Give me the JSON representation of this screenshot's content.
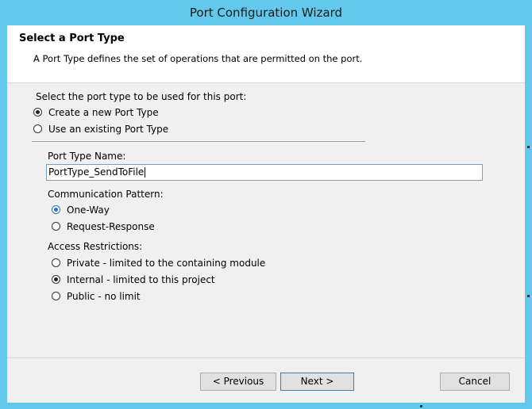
{
  "window": {
    "title": "Port Configuration Wizard"
  },
  "header": {
    "title": "Select a Port Type",
    "description": "A Port Type defines the set of operations that are permitted on the port."
  },
  "port_type_choice": {
    "prompt": "Select the port type to be used for this port:",
    "create_new": "Create a new Port Type",
    "use_existing": "Use an existing Port Type",
    "selected": "create_new"
  },
  "port_type_name": {
    "label": "Port Type Name:",
    "value": "PortType_SendToFile"
  },
  "communication_pattern": {
    "label": "Communication Pattern:",
    "one_way": "One-Way",
    "request_response": "Request-Response",
    "selected": "one_way"
  },
  "access_restrictions": {
    "label": "Access Restrictions:",
    "private": "Private - limited to the containing module",
    "internal": "Internal - limited to this project",
    "public": "Public - no limit",
    "selected": "internal"
  },
  "buttons": {
    "previous": "< Previous",
    "next": "Next >",
    "cancel": "Cancel"
  }
}
